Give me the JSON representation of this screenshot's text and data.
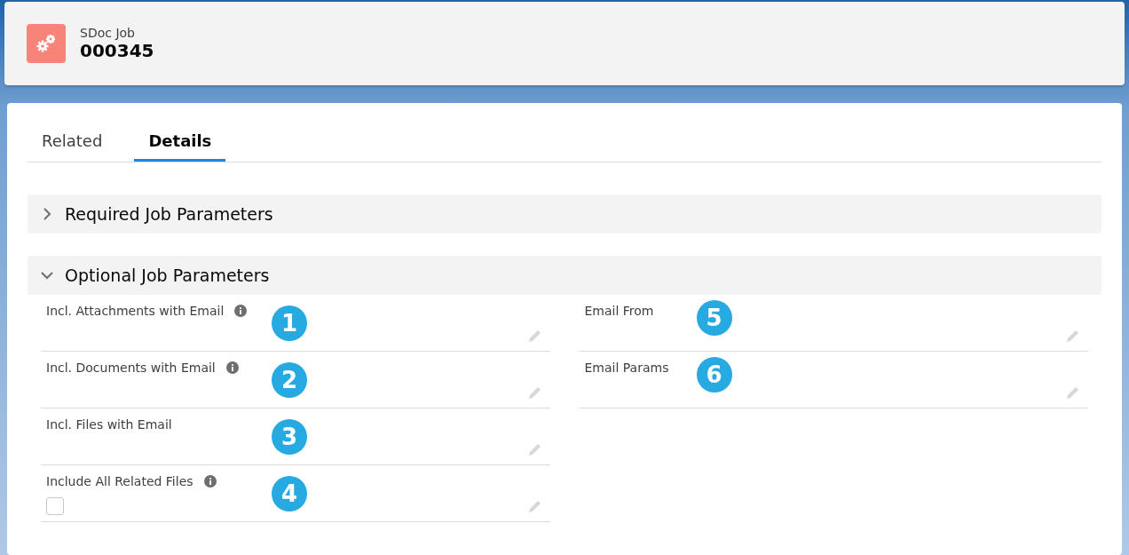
{
  "header": {
    "object_type": "SDoc Job",
    "record_name": "000345"
  },
  "tabs": [
    {
      "label": "Related",
      "selected": false
    },
    {
      "label": "Details",
      "selected": true
    }
  ],
  "sections": [
    {
      "title": "Required Job Parameters",
      "expanded": false
    },
    {
      "title": "Optional Job Parameters",
      "expanded": true,
      "left_column": [
        {
          "label": "Incl. Attachments with Email",
          "info": true,
          "kind": "text",
          "callout": "1"
        },
        {
          "label": "Incl. Documents with Email",
          "info": true,
          "kind": "text",
          "callout": "2"
        },
        {
          "label": "Incl. Files with Email",
          "info": false,
          "kind": "text",
          "callout": "3"
        },
        {
          "label": "Include All Related Files",
          "info": true,
          "kind": "checkbox",
          "checked": false,
          "callout": "4"
        }
      ],
      "right_column": [
        {
          "label": "Email From",
          "info": false,
          "kind": "text",
          "callout": "5"
        },
        {
          "label": "Email Params",
          "info": false,
          "kind": "text",
          "callout": "6"
        }
      ]
    }
  ]
}
